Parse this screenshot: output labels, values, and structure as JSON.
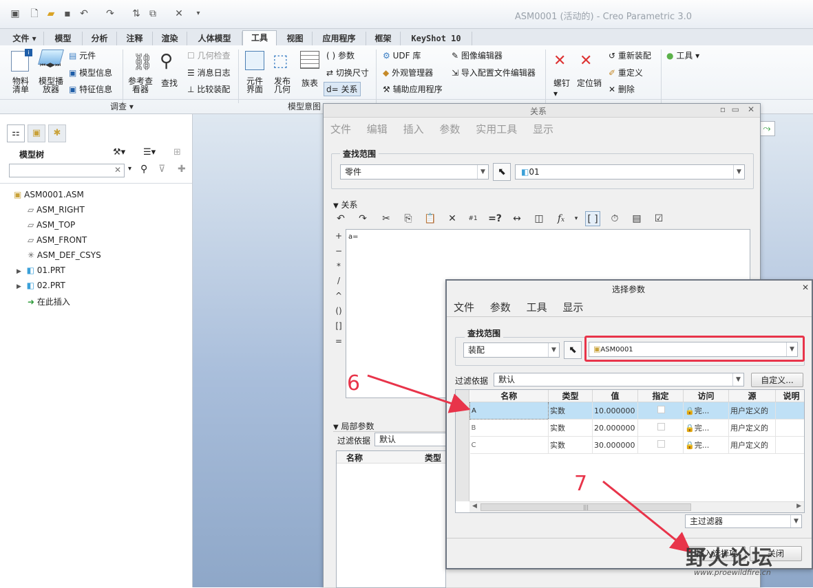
{
  "window": {
    "title": "ASM0001 (活动的) - Creo Parametric 3.0"
  },
  "quick_access": {
    "icons": [
      "window-icon",
      "new-file-icon",
      "open-file-icon",
      "save-icon",
      "undo-icon",
      "redo-icon",
      "regenerate-icon",
      "windows-icon",
      "close-window-icon",
      "customize-icon"
    ]
  },
  "ribbon_tabs": [
    "文件",
    "模型",
    "分析",
    "注释",
    "渲染",
    "人体模型",
    "工具",
    "视图",
    "应用程序",
    "框架",
    "KeyShot 10"
  ],
  "ribbon": {
    "bom": "物料\n清单",
    "model_player": "模型播\n放器",
    "component": "元件",
    "model_info": "模型信息",
    "feature_info": "特征信息",
    "ref_viewer": "参考查\n看器",
    "find": "查找",
    "geom_check": "几何检查",
    "message_log": "消息日志",
    "compare_assembly": "比较装配",
    "comp_interface": "元件\n界面",
    "publish_geom": "发布\n几何",
    "family_table": "族表",
    "parameters": "参数",
    "switch_dims": "切换尺寸",
    "relations": "关系",
    "udf_lib": "UDF 库",
    "appearance_mgr": "外观管理器",
    "aux_app": "辅助应用程序",
    "image_editor": "图像编辑器",
    "import_config_editor": "导入配置文件编辑器",
    "screw": "螺钉",
    "locator": "定位销",
    "reassemble": "重新装配",
    "redefine": "重定义",
    "delete": "删除",
    "tools": "工具",
    "group_investigate": "调查",
    "group_model_intent": "模型意图"
  },
  "model_tree": {
    "title": "模型树",
    "items": [
      "ASM0001.ASM",
      "ASM_RIGHT",
      "ASM_TOP",
      "ASM_FRONT",
      "ASM_DEF_CSYS",
      "01.PRT",
      "02.PRT",
      "在此插入"
    ]
  },
  "relations_dialog": {
    "title": "关系",
    "menu": [
      "文件",
      "编辑",
      "插入",
      "参数",
      "实用工具",
      "显示"
    ],
    "scope_label": "查找范围",
    "scope_type": "零件",
    "scope_value": "01",
    "section": "关系",
    "editor_text": "a=",
    "side_ops": [
      "+",
      "−",
      "*",
      "/",
      "^",
      "()",
      "[]",
      "="
    ],
    "local_params": "局部参数",
    "filter_label": "过滤依据",
    "filter_value": "默认",
    "col_name": "名称",
    "col_type": "类型"
  },
  "select_param_dialog": {
    "title": "选择参数",
    "menu": [
      "文件",
      "参数",
      "工具",
      "显示"
    ],
    "scope_label": "查找范围",
    "scope_type": "装配",
    "scope_value": "ASM0001",
    "filter_label": "过滤依据",
    "filter_value": "默认",
    "custom_btn": "自定义...",
    "columns": [
      "名称",
      "类型",
      "值",
      "指定",
      "访问",
      "源",
      "说明"
    ],
    "rows": [
      {
        "name": "A",
        "type": "实数",
        "value": "10.000000",
        "access": "完...",
        "source": "用户定义的"
      },
      {
        "name": "B",
        "type": "实数",
        "value": "20.000000",
        "access": "完...",
        "source": "用户定义的"
      },
      {
        "name": "C",
        "type": "实数",
        "value": "30.000000",
        "access": "完...",
        "source": "用户定义的"
      }
    ],
    "main_filter": "主过滤器",
    "insert_btn": "插入选择项",
    "close_btn": "关闭"
  },
  "annotations": {
    "step6": "6",
    "step7": "7"
  },
  "watermark": {
    "text": "野火论坛",
    "url": "www.proewildfire.cn"
  }
}
